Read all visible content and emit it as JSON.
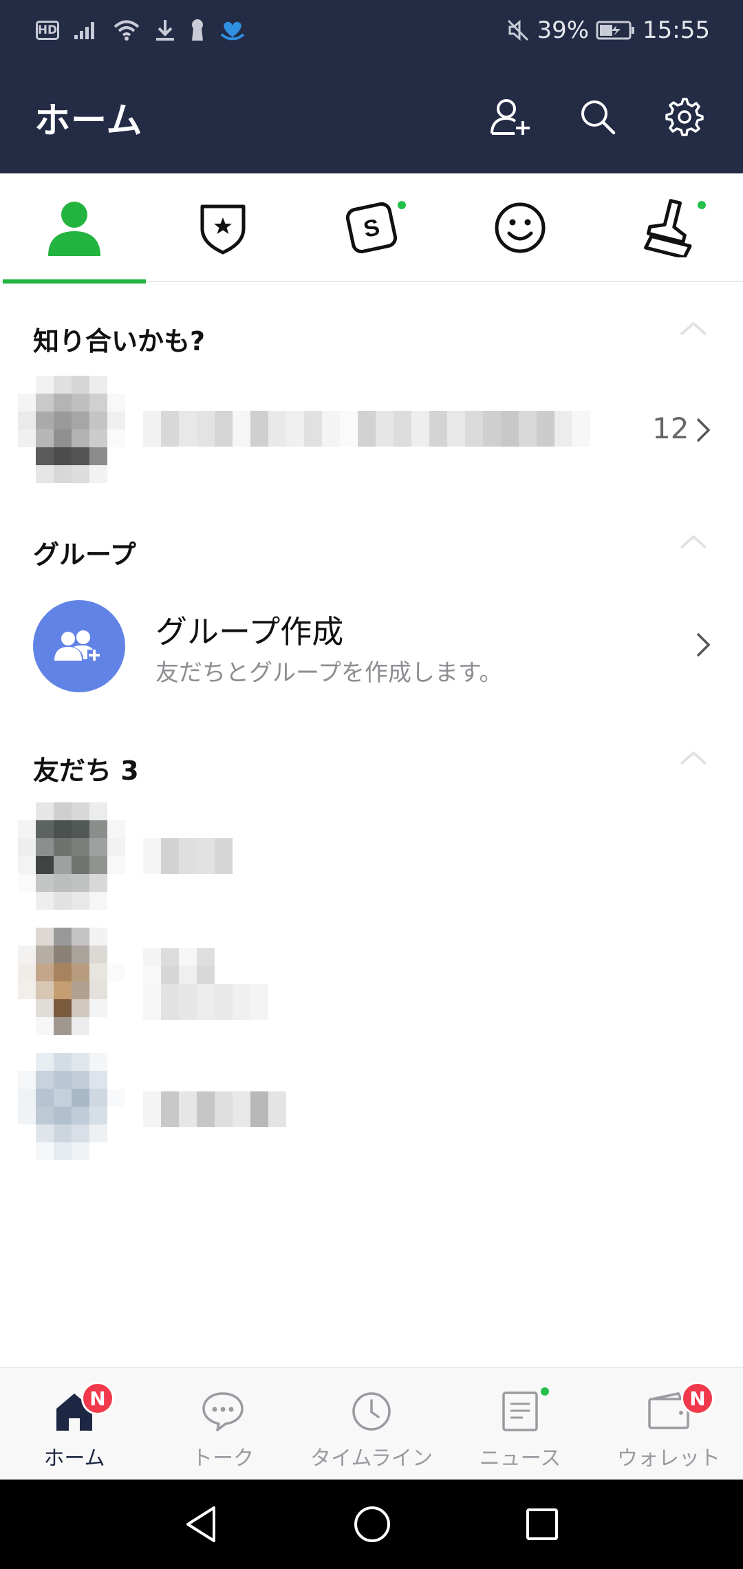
{
  "status_bar": {
    "hd": "HD",
    "battery": "39%",
    "time": "15:55"
  },
  "header": {
    "title": "ホーム"
  },
  "category_tabs": [
    "friends",
    "official",
    "sticker-shop",
    "emoji",
    "theme"
  ],
  "sections": {
    "suggestions": {
      "title": "知り合いかも?",
      "count": "12"
    },
    "groups": {
      "title": "グループ",
      "create_title": "グループ作成",
      "create_subtitle": "友だちとグループを作成します。"
    },
    "friends": {
      "title": "友だち 3"
    }
  },
  "bottom_nav": {
    "items": [
      {
        "label": "ホーム",
        "badge": "N"
      },
      {
        "label": "トーク"
      },
      {
        "label": "タイムライン"
      },
      {
        "label": "ニュース"
      },
      {
        "label": "ウォレット",
        "badge": "N"
      }
    ]
  },
  "colors": {
    "header_bg": "#232b45",
    "accent_green": "#23b33f",
    "badge_red": "#f2384b",
    "group_blue": "#6283e6"
  }
}
